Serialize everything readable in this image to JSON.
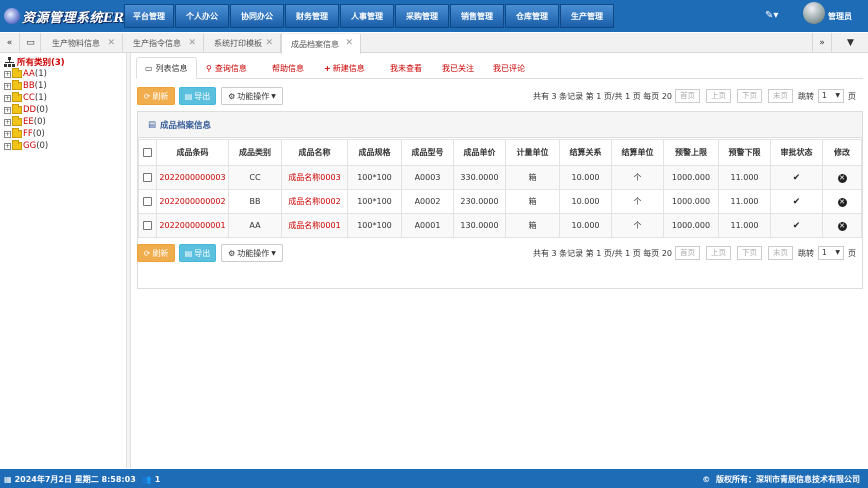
{
  "app": {
    "title": "资源管理系统ERP",
    "user": "管理员"
  },
  "main_nav": [
    "平台管理",
    "个人办公",
    "协同办公",
    "财务管理",
    "人事管理",
    "采购管理",
    "销售管理",
    "仓库管理",
    "生产管理"
  ],
  "tabs": [
    {
      "label": "生产物料信息",
      "active": false
    },
    {
      "label": "生产指令信息",
      "active": false
    },
    {
      "label": "系统打印模板",
      "active": false
    },
    {
      "label": "成品档案信息",
      "active": true
    }
  ],
  "sidebar": {
    "root": "所有类别(3)",
    "nodes": [
      {
        "name": "AA",
        "count": "(1)"
      },
      {
        "name": "BB",
        "count": "(1)"
      },
      {
        "name": "CC",
        "count": "(1)"
      },
      {
        "name": "DD",
        "count": "(0)"
      },
      {
        "name": "EE",
        "count": "(0)"
      },
      {
        "name": "FF",
        "count": "(0)"
      },
      {
        "name": "GG",
        "count": "(0)"
      }
    ]
  },
  "subtabs": [
    "列表信息",
    "查询信息",
    "帮助信息",
    "新建信息",
    "我未查看",
    "我已关注",
    "我已评论"
  ],
  "toolbar": {
    "refresh": "刷新",
    "export": "导出",
    "functions": "功能操作"
  },
  "pager": {
    "summary": "共有 3 条记录 第 1 页/共 1 页 每页 20",
    "first": "首页",
    "prev": "上页",
    "next": "下页",
    "last": "末页",
    "jump": "跳转",
    "page": "1",
    "page_unit": "页"
  },
  "panel_title": "成品档案信息",
  "table": {
    "columns": [
      "成品条码",
      "成品类别",
      "成品名称",
      "成品规格",
      "成品型号",
      "成品单价",
      "计量单位",
      "结算关系",
      "结算单位",
      "预警上限",
      "预警下限",
      "审批状态",
      "修改"
    ],
    "rows": [
      [
        "2022000000003",
        "CC",
        "成品名称0003",
        "100*100",
        "A0003",
        "330.0000",
        "箱",
        "10.000",
        "个",
        "1000.000",
        "11.000"
      ],
      [
        "2022000000002",
        "BB",
        "成品名称0002",
        "100*100",
        "A0002",
        "230.0000",
        "箱",
        "10.000",
        "个",
        "1000.000",
        "11.000"
      ],
      [
        "2022000000001",
        "AA",
        "成品名称0001",
        "100*100",
        "A0001",
        "130.0000",
        "箱",
        "10.000",
        "个",
        "1000.000",
        "11.000"
      ]
    ]
  },
  "footer": {
    "datetime": "2024年7月2日 星期二 8:58:03",
    "online": "1",
    "copyright": "版权所有：深圳市青辰信息技术有限公司"
  },
  "colors": {
    "primary": "#1f6cb6",
    "accent_red": "#cc0000",
    "refresh": "#f0ad4e",
    "export": "#5bc0de"
  }
}
